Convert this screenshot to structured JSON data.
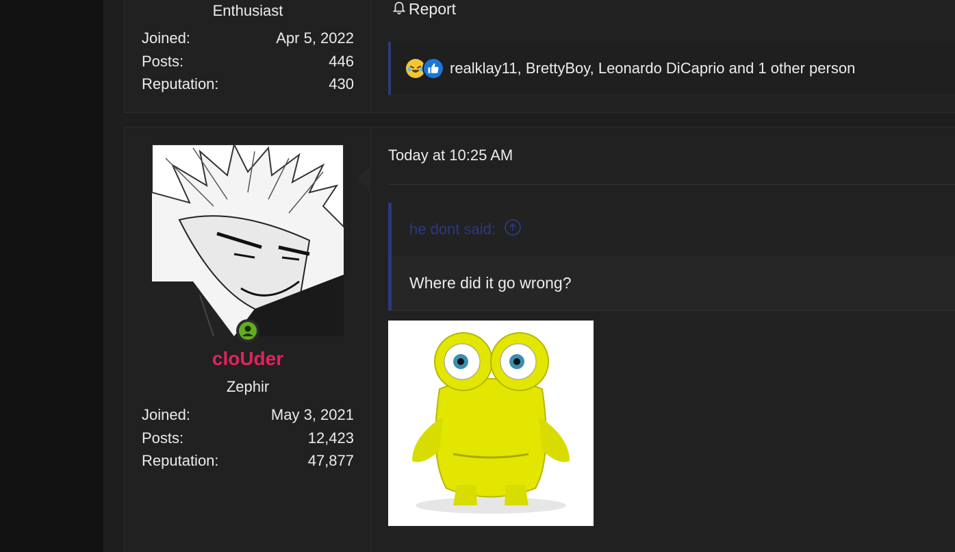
{
  "top_post": {
    "user_title": "Enthusiast",
    "stats": [
      {
        "label": "Joined:",
        "value": "Apr 5, 2022"
      },
      {
        "label": "Posts:",
        "value": "446"
      },
      {
        "label": "Reputation:",
        "value": "430"
      }
    ],
    "report_label": "Report",
    "reactions_text": "realklay11, BrettyBoy, Leonardo DiCaprio and 1 other person"
  },
  "main_post": {
    "username": "cloUder",
    "user_title": "Zephir",
    "stats": [
      {
        "label": "Joined:",
        "value": "May 3, 2021"
      },
      {
        "label": "Posts:",
        "value": "12,423"
      },
      {
        "label": "Reputation:",
        "value": "47,877"
      }
    ],
    "timestamp": "Today at 10:25 AM",
    "quote": {
      "author_line": "he dont said:",
      "text": "Where did it go wrong?"
    }
  },
  "colors": {
    "username": "#e0245e",
    "quote_accent": "#2b3980",
    "online_badge": "#5fae1f"
  },
  "icons": {
    "report": "bell-icon",
    "reaction_1": "laughing-emoji-icon",
    "reaction_2": "thumbs-up-icon",
    "online": "online-status-icon",
    "quote_jump": "arrow-up-circle-icon"
  }
}
